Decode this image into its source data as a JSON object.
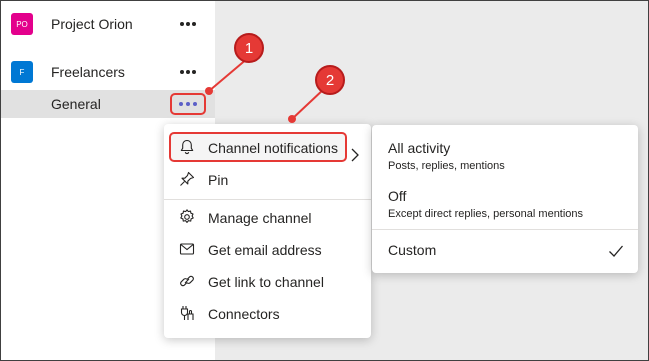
{
  "sidebar": {
    "teams": [
      {
        "initials": "PO",
        "name": "Project Orion",
        "color": "#e3008c"
      },
      {
        "initials": "F",
        "name": "Freelancers",
        "color": "#0078d4"
      }
    ],
    "channel": {
      "name": "General"
    }
  },
  "menu": {
    "items": [
      {
        "label": "Channel notifications",
        "icon": "bell-icon"
      },
      {
        "label": "Pin",
        "icon": "pin-icon"
      },
      {
        "label": "Manage channel",
        "icon": "gear-icon"
      },
      {
        "label": "Get email address",
        "icon": "mail-icon"
      },
      {
        "label": "Get link to channel",
        "icon": "link-icon"
      },
      {
        "label": "Connectors",
        "icon": "connectors-icon"
      }
    ]
  },
  "submenu": {
    "options": [
      {
        "title": "All activity",
        "desc": "Posts, replies, mentions"
      },
      {
        "title": "Off",
        "desc": "Except direct replies, personal mentions"
      },
      {
        "title": "Custom",
        "desc": ""
      }
    ]
  },
  "callouts": [
    "1",
    "2"
  ],
  "colors": {
    "highlight": "#e53935",
    "accent": "#5b5fc7"
  }
}
